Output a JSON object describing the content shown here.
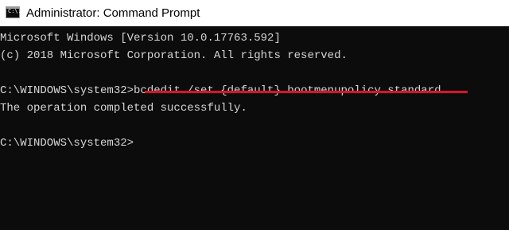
{
  "window": {
    "title": "Administrator: Command Prompt",
    "icon": "command-prompt-icon",
    "icon_glyph": "C:\\."
  },
  "console": {
    "lines": [
      "Microsoft Windows [Version 10.0.17763.592]",
      "(c) 2018 Microsoft Corporation. All rights reserved.",
      "",
      "",
      "The operation completed successfully.",
      "",
      "C:\\WINDOWS\\system32>"
    ],
    "prompt": "C:\\WINDOWS\\system32>",
    "command": "bcdedit /set {default} bootmenupolicy standard"
  },
  "colors": {
    "background": "#0c0c0c",
    "text": "#d6d6d6",
    "highlight_underline": "#e0112a"
  }
}
